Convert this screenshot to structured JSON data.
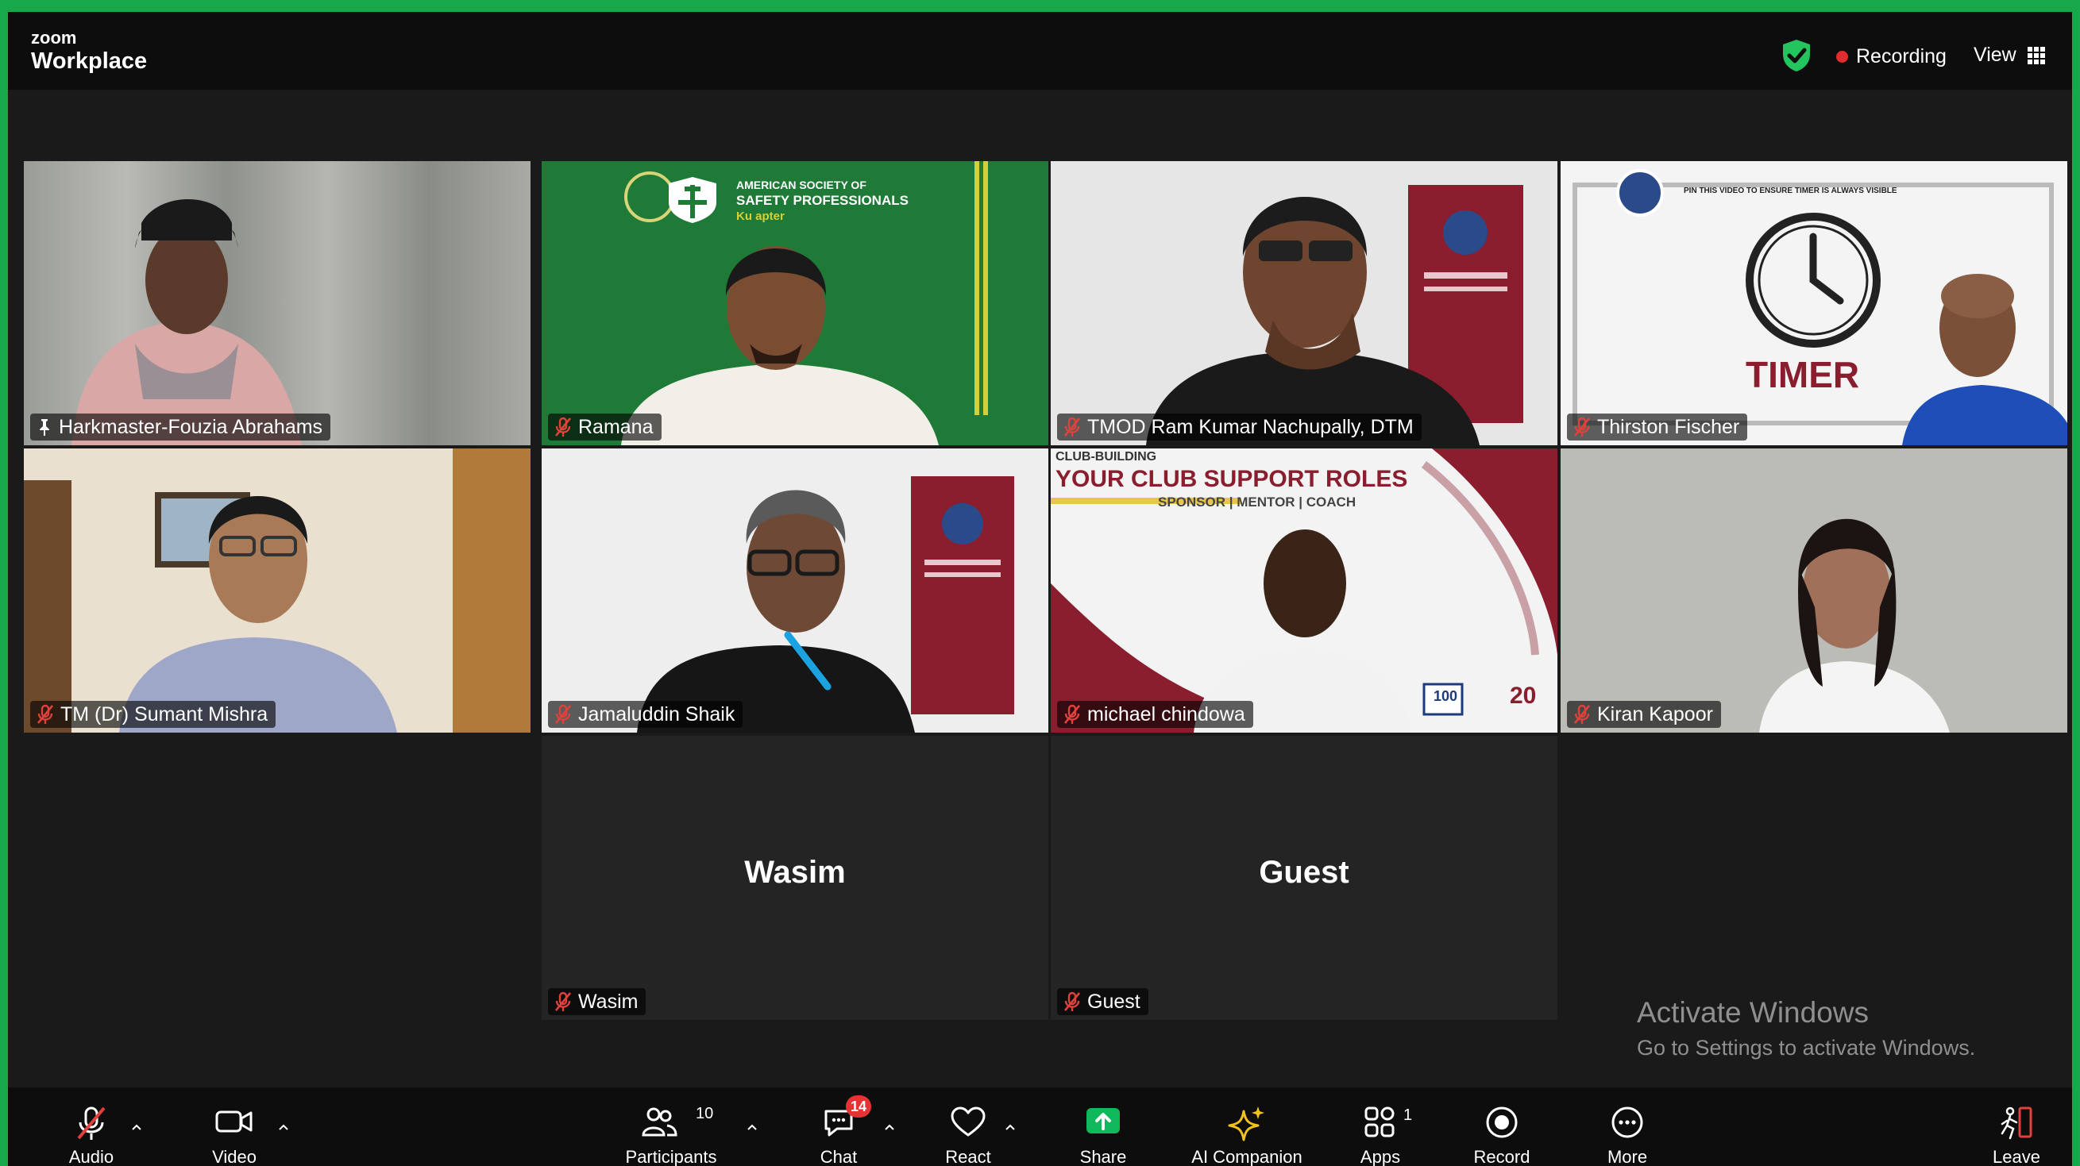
{
  "app": {
    "brand_small": "zoom",
    "brand_name": "Workplace"
  },
  "header": {
    "recording_label": "Recording",
    "view_label": "View"
  },
  "participants": [
    {
      "name": "Harkmaster-Fouzia Abrahams",
      "muted": false,
      "pinned": true,
      "active_speaker": true
    },
    {
      "name": "Ramana",
      "muted": true
    },
    {
      "name": "TMOD Ram Kumar Nachupally, DTM",
      "muted": true
    },
    {
      "name": "Thirston Fischer",
      "muted": true
    },
    {
      "name": "TM (Dr) Sumant Mishra",
      "muted": true
    },
    {
      "name": "Jamaluddin Shaik",
      "muted": true
    },
    {
      "name": "michael chindowa",
      "muted": true
    },
    {
      "name": "Kiran Kapoor",
      "muted": true
    },
    {
      "name": "Wasim",
      "muted": true,
      "video_off": true,
      "display_name": "Wasim"
    },
    {
      "name": "Guest",
      "muted": true,
      "video_off": true,
      "display_name": "Guest"
    }
  ],
  "backgrounds": {
    "asp_line1": "AMERICAN SOCIETY OF",
    "asp_line2": "SAFETY PROFESSIONALS",
    "asp_line3": "Ku    apter",
    "timer_banner": "PIN THIS VIDEO TO ENSURE TIMER IS ALWAYS VISIBLE",
    "timer_label": "TIMER",
    "club_kicker": "CLUB-BUILDING",
    "club_title": "YOUR CLUB SUPPORT ROLES",
    "club_subtitle": "SPONSOR | MENTOR | COACH",
    "badge_100": "100",
    "badge_20": "20"
  },
  "watermark": {
    "line1": "Activate Windows",
    "line2": "Go to Settings to activate Windows."
  },
  "toolbar": {
    "audio": "Audio",
    "video": "Video",
    "participants": "Participants",
    "participants_count": "10",
    "chat": "Chat",
    "chat_badge": "14",
    "react": "React",
    "share": "Share",
    "ai_companion": "AI Companion",
    "apps": "Apps",
    "apps_count": "1",
    "record": "Record",
    "more": "More",
    "leave": "Leave"
  },
  "colors": {
    "frame_green": "#17a84a",
    "active_speaker": "#1fd36c",
    "share_green": "#0fb85a",
    "badge_red": "#e53232",
    "mic_off_red": "#e0413c"
  }
}
